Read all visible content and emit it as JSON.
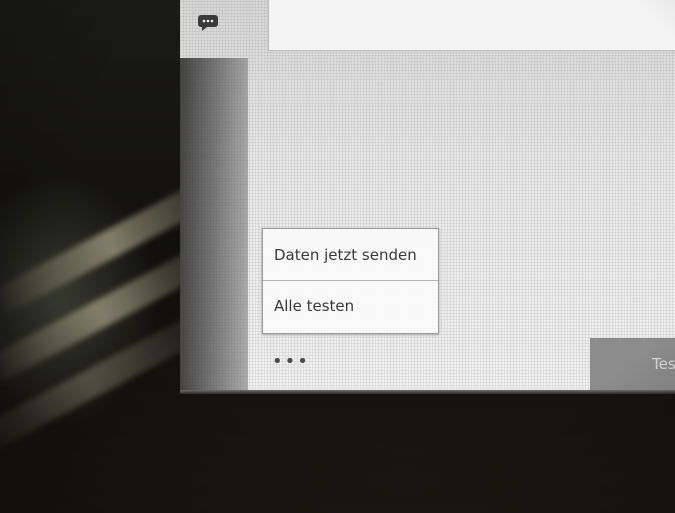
{
  "menu": {
    "items": [
      {
        "label": "Daten jetzt senden"
      },
      {
        "label": "Alle testen"
      }
    ]
  },
  "more": {
    "label": "•••"
  },
  "test_button": {
    "label": "Tes"
  },
  "icons": {
    "chat": "chat-bubble-icon"
  }
}
